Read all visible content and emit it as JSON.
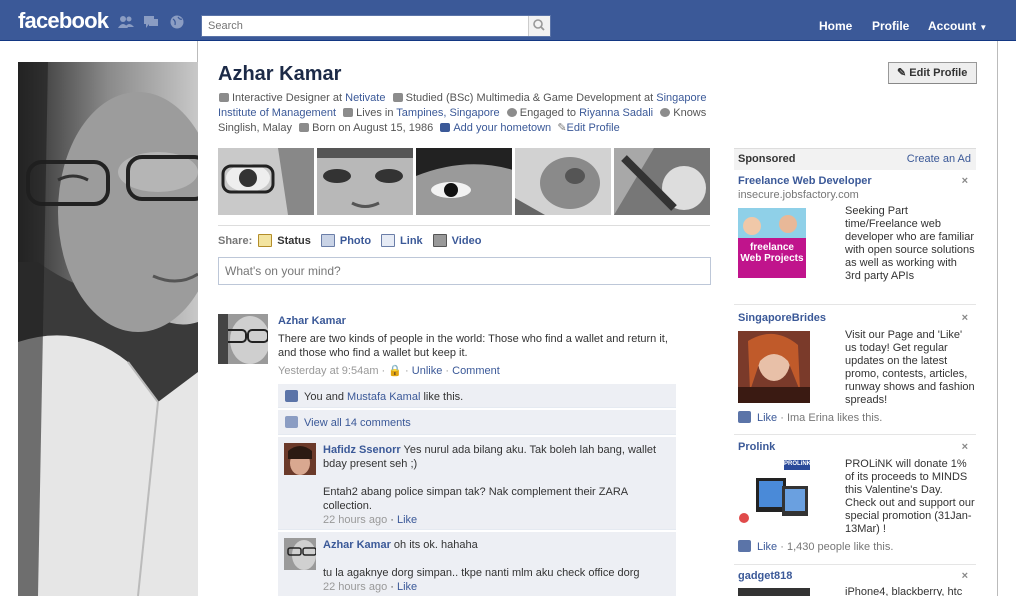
{
  "topbar": {
    "logo": "facebook",
    "search_placeholder": "Search",
    "nav": {
      "home": "Home",
      "profile": "Profile",
      "account": "Account"
    }
  },
  "profile": {
    "name": "Azhar Kamar",
    "edit_button": "Edit Profile",
    "info": {
      "job_prefix": "Interactive Designer at ",
      "job_link": "Netivate",
      "study_prefix": "Studied (BSc) Multimedia & Game Development at ",
      "study_link": "Singapore Institute of Management",
      "lives_prefix": "Lives in ",
      "lives_link": "Tampines, Singapore",
      "engaged_prefix": "Engaged to ",
      "engaged_link": "Riyanna Sadali",
      "knows": "Knows Singlish, Malay",
      "born": "Born on August 15, 1986",
      "add_hometown": "Add your hometown",
      "edit_profile": "Edit Profile"
    }
  },
  "publisher": {
    "share_label": "Share:",
    "options": [
      "Status",
      "Photo",
      "Link",
      "Video"
    ],
    "placeholder": "What's on your mind?"
  },
  "story": {
    "author": "Azhar Kamar",
    "text": "There are two kinds of people in the world: Those who find a wallet and return it, and those who find a wallet but keep it.",
    "time": "Yesterday at 9:54am",
    "unlike": "Unlike",
    "comment": "Comment",
    "likes_prefix": "You and ",
    "likes_link": "Mustafa Kamal",
    "likes_suffix": " like this.",
    "view_all": "View all 14 comments",
    "comments": [
      {
        "author": "Hafidz Ssenorr",
        "text": "Yes nurul ada bilang aku. Tak boleh lah bang, wallet bday present seh ;)",
        "text2": "Entah2 abang police simpan tak? Nak complement their ZARA collection.",
        "time": "22 hours ago",
        "like": "Like"
      },
      {
        "author": "Azhar Kamar",
        "text": "oh its ok. hahaha",
        "text2": "tu la agaknye dorg simpan.. tkpe nanti mlm aku check office dorg",
        "time": "22 hours ago",
        "like": "Like"
      }
    ]
  },
  "sidebar": {
    "sponsored": "Sponsored",
    "create_ad": "Create an Ad",
    "close": "×",
    "ads": [
      {
        "title": "Freelance Web Developer",
        "url": "insecure.jobsfactory.com",
        "text": "Seeking Part time/Freelance web developer who are familiar with open source solutions as well as working with 3rd party APIs",
        "image_caption": "freelance Web Projects"
      },
      {
        "title": "SingaporeBrides",
        "text": "Visit our Page and 'Like' us today! Get regular updates on the latest promo, contests, articles, runway shows and fashion spreads!",
        "like": "Like",
        "like_text": " · Ima Erina likes this."
      },
      {
        "title": "Prolink",
        "text": "PROLiNK will donate 1% of its proceeds to MINDS this Valentine's Day. Check out and support our special promotion (31Jan-13Mar) !",
        "like": "Like",
        "like_text": " · 1,430 people like this.",
        "image_caption": "PROLiNK"
      },
      {
        "title": "gadget818",
        "text": "iPhone4, blackberry, htc"
      }
    ]
  },
  "colors": {
    "brand": "#3b5998",
    "link": "#3b5998",
    "ufi_bg": "#edeff4"
  }
}
